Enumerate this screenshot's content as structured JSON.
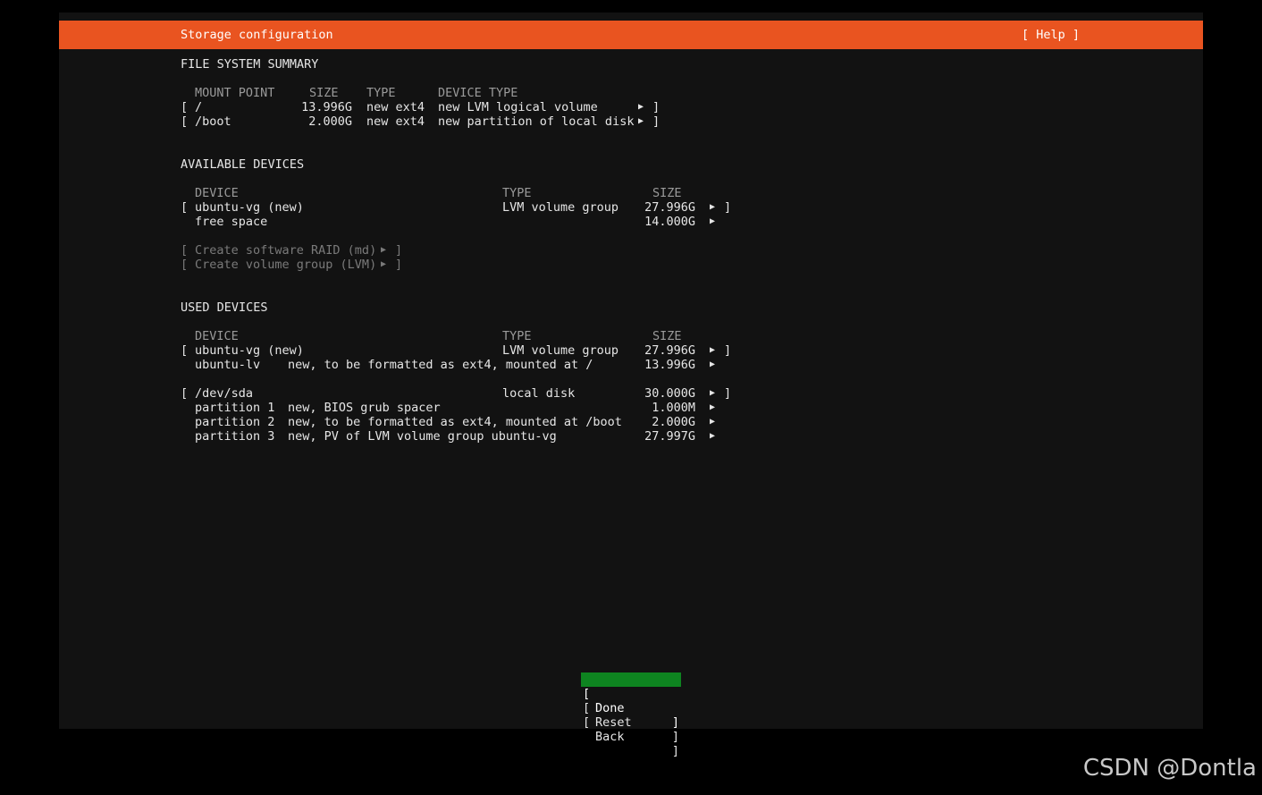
{
  "header": {
    "title": "Storage configuration",
    "help": "[ Help ]"
  },
  "fs_summary": {
    "heading": "FILE SYSTEM SUMMARY",
    "columns": {
      "mount_point": "MOUNT POINT",
      "size": "SIZE",
      "type": "TYPE",
      "device_type": "DEVICE TYPE"
    },
    "rows": [
      {
        "mount": "/",
        "size": "13.996G",
        "type": "new ext4",
        "device_type": "new LVM logical volume"
      },
      {
        "mount": "/boot",
        "size": "2.000G",
        "type": "new ext4",
        "device_type": "new partition of local disk"
      }
    ]
  },
  "available": {
    "heading": "AVAILABLE DEVICES",
    "columns": {
      "device": "DEVICE",
      "type": "TYPE",
      "size": "SIZE"
    },
    "vg": {
      "name": "ubuntu-vg (new)",
      "type": "LVM volume group",
      "size": "27.996G"
    },
    "free": {
      "name": "free space",
      "size": "14.000G"
    },
    "actions": {
      "raid": "Create software RAID (md)",
      "lvm": "Create volume group (LVM)"
    }
  },
  "used": {
    "heading": "USED DEVICES",
    "columns": {
      "device": "DEVICE",
      "type": "TYPE",
      "size": "SIZE"
    },
    "vg": {
      "name": "ubuntu-vg (new)",
      "type": "LVM volume group",
      "size": "27.996G"
    },
    "lv": {
      "name": "ubuntu-lv",
      "desc": "new, to be formatted as ext4, mounted at /",
      "size": "13.996G"
    },
    "disk": {
      "name": "/dev/sda",
      "type": "local disk",
      "size": "30.000G"
    },
    "partitions": [
      {
        "name": "partition 1",
        "desc": "new, BIOS grub spacer",
        "size": "1.000M"
      },
      {
        "name": "partition 2",
        "desc": "new, to be formatted as ext4, mounted at /boot",
        "size": "2.000G"
      },
      {
        "name": "partition 3",
        "desc": "new, PV of LVM volume group ubuntu-vg",
        "size": "27.997G"
      }
    ]
  },
  "buttons": {
    "done": "Done",
    "reset": "Reset",
    "back": "Back"
  },
  "glyphs": {
    "arrow": "▶",
    "lbr": "[",
    "rbr": "]"
  },
  "watermark": "CSDN @Dontla",
  "colors": {
    "accent": "#e95420",
    "focus": "#0e8420",
    "background": "#121212"
  }
}
